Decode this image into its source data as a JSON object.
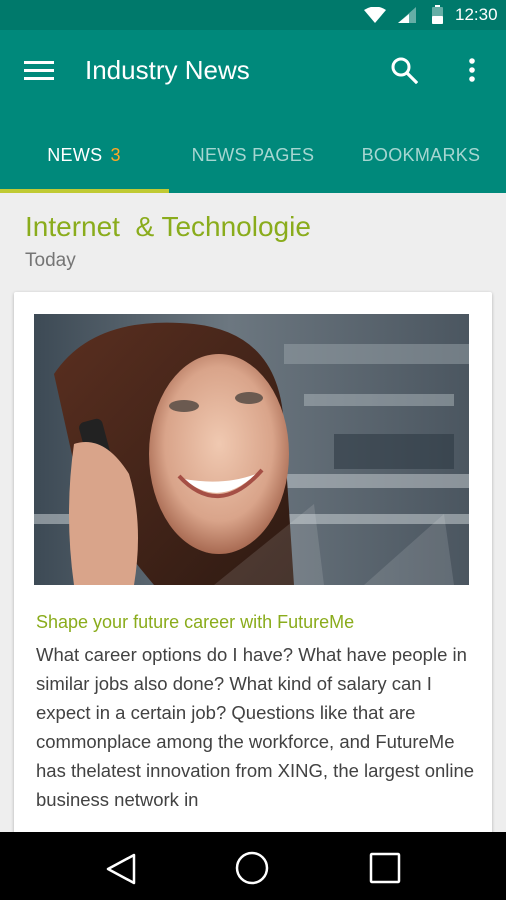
{
  "status_bar": {
    "time": "12:30",
    "icons": [
      "wifi-icon",
      "signal-icon",
      "battery-icon"
    ]
  },
  "app_bar": {
    "title": "Industry News",
    "icons": [
      "menu-icon",
      "search-icon",
      "more-vert-icon"
    ],
    "background": "#00897b"
  },
  "tabs": [
    {
      "label": "NEWS",
      "count": "3",
      "active": true
    },
    {
      "label": "NEWS PAGES",
      "active": false
    },
    {
      "label": "BOOKMARKS",
      "active": false
    }
  ],
  "section": {
    "title": "Internet  & Technologie",
    "date": "Today"
  },
  "article": {
    "headline": "Shape your future career with FutureMe",
    "body": "What career options do I have? What have people in similar jobs also done? What kind of salary can I expect in a certain job? Questions like that are commonplace among the workforce, and FutureMe has thelatest innovation from XING, the largest online business network in"
  },
  "nav_bar": {
    "icons": [
      "back-icon",
      "home-icon",
      "recent-apps-icon"
    ]
  },
  "colors": {
    "status_bar": "#00796b",
    "app_bar": "#00897b",
    "accent_green": "#8aac1c",
    "tab_indicator": "#c0ca33",
    "badge_orange": "#ffa726"
  }
}
